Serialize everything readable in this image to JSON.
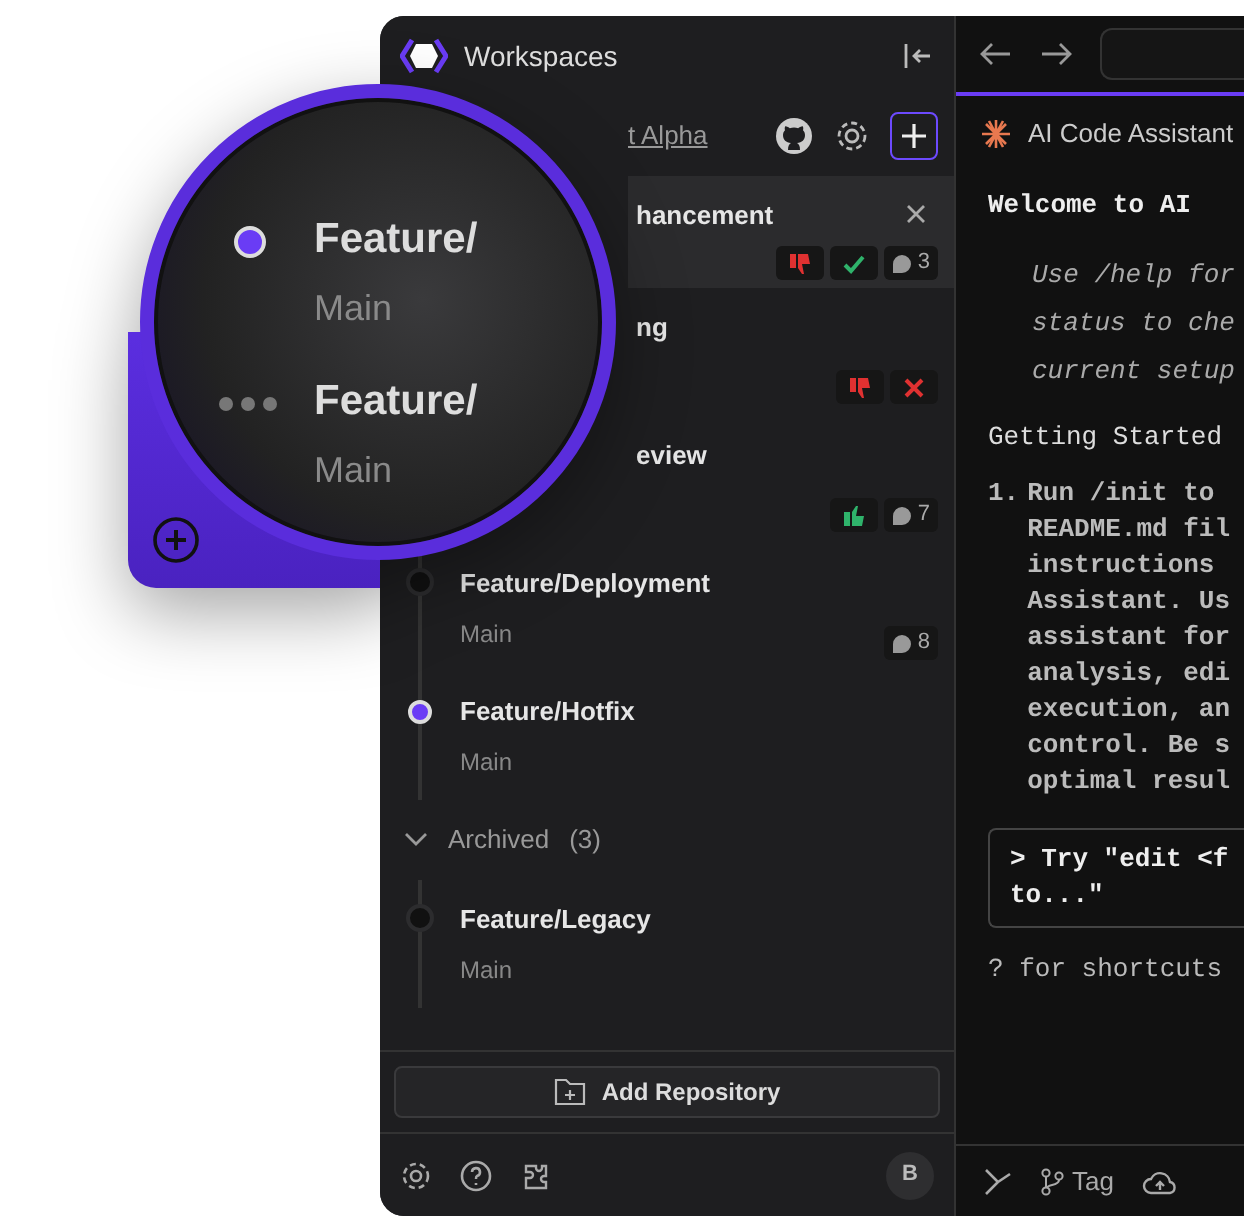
{
  "window": {
    "title": "Workspaces"
  },
  "repo": {
    "name": "t Alpha"
  },
  "branches": [
    {
      "title": "hancement",
      "selected": true,
      "badges": [
        {
          "kind": "thumbs_down"
        },
        {
          "kind": "check"
        },
        {
          "kind": "comments",
          "count": "3"
        }
      ]
    },
    {
      "title": "ng",
      "selected": false,
      "badges": [
        {
          "kind": "thumbs_down"
        },
        {
          "kind": "cross"
        }
      ]
    },
    {
      "title": "eview",
      "selected": false,
      "badges": [
        {
          "kind": "thumbs_up"
        },
        {
          "kind": "comments",
          "count": "7"
        }
      ]
    },
    {
      "title": "Feature/Deployment",
      "subtitle": "Main",
      "selected": false,
      "active": false,
      "badges": [
        {
          "kind": "comments",
          "count": "8"
        }
      ]
    },
    {
      "title": "Feature/Hotfix",
      "subtitle": "Main",
      "selected": false,
      "active": true
    }
  ],
  "archived": {
    "label": "Archived",
    "count": "(3)",
    "expanded": true,
    "branches": [
      {
        "title": "Feature/Legacy",
        "subtitle": "Main",
        "active": false
      }
    ]
  },
  "add_button": "Add Repository",
  "avatar": "B",
  "magnifier": {
    "items": [
      {
        "title": "Feature/",
        "subtitle": "Main",
        "kind": "dot"
      },
      {
        "title": "Feature/",
        "subtitle": "Main",
        "kind": "dots"
      }
    ]
  },
  "assistant": {
    "title": "AI Code Assistant",
    "welcome": "Welcome to AI",
    "tips": [
      "Use /help for",
      "status to che",
      "current setup"
    ],
    "heading": "Getting Started",
    "steps": [
      {
        "number": "1.",
        "lines": [
          "Run /init to",
          "README.md fil",
          "instructions",
          "Assistant. Us",
          "assistant for",
          "analysis, edi",
          "execution, an",
          "control. Be s",
          "optimal resul"
        ]
      }
    ],
    "prompt": [
      "> Try \"edit <f",
      "to...\""
    ],
    "shortcuts": "? for shortcuts"
  },
  "toolbar": {
    "tag": "Tag"
  }
}
